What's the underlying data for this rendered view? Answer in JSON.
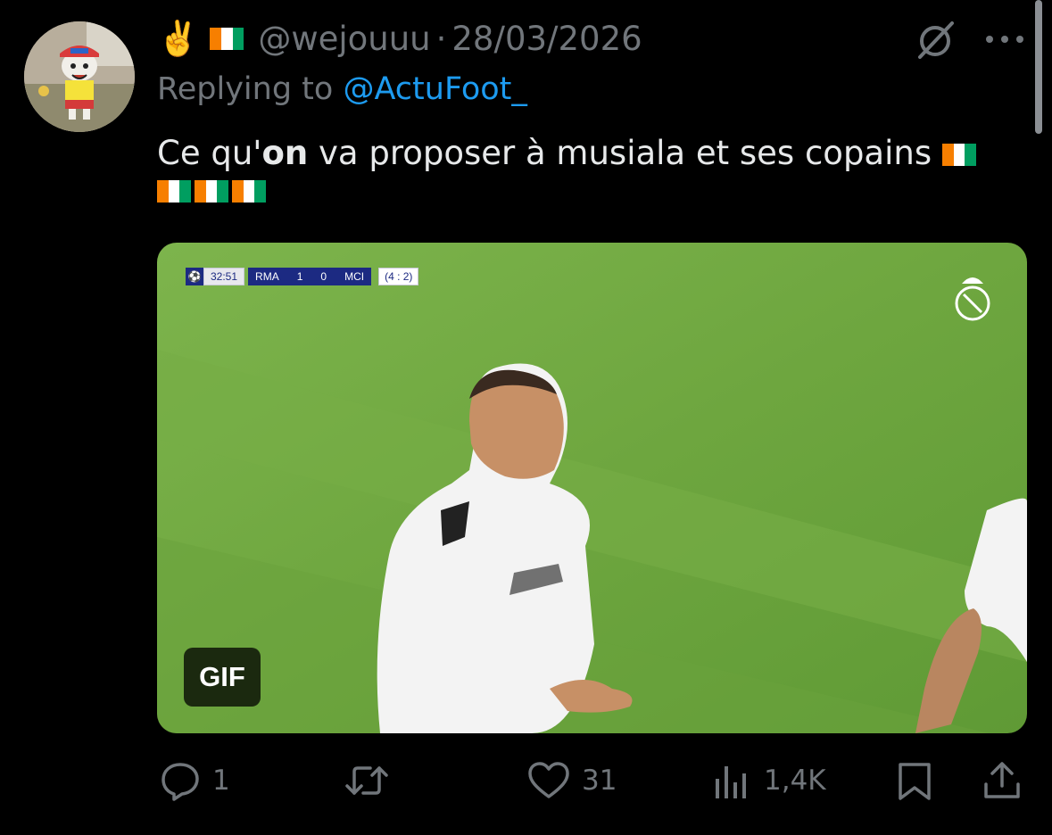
{
  "tweet": {
    "emoji": "✌️",
    "handle": "@wejouuu",
    "separator": "·",
    "date": "28/03/2026",
    "reply_prefix": "Replying to",
    "reply_to": "@ActuFoot_",
    "text_before": "Ce qu'",
    "text_bold": "on",
    "text_after": " va proposer à musiala et ses copains "
  },
  "media": {
    "badge": "GIF",
    "scorebug": {
      "time": "32:51",
      "home": "RMA",
      "home_score": "1",
      "away_score": "0",
      "away": "MCI",
      "aggregate": "(4 : 2)"
    }
  },
  "actions": {
    "reply_count": "1",
    "repost_count": "",
    "like_count": "31",
    "view_count": "1,4K"
  },
  "icons": {
    "grok": "grok-icon",
    "more": "more-icon",
    "reply": "reply-icon",
    "repost": "repost-icon",
    "like": "like-icon",
    "views": "views-icon",
    "bookmark": "bookmark-icon",
    "share": "share-icon"
  },
  "colors": {
    "background": "#000000",
    "text": "#e7e9ea",
    "muted": "#71767b",
    "link": "#1d9bf0",
    "flag_orange": "#f77f00",
    "flag_white": "#ffffff",
    "flag_green": "#009e60"
  }
}
